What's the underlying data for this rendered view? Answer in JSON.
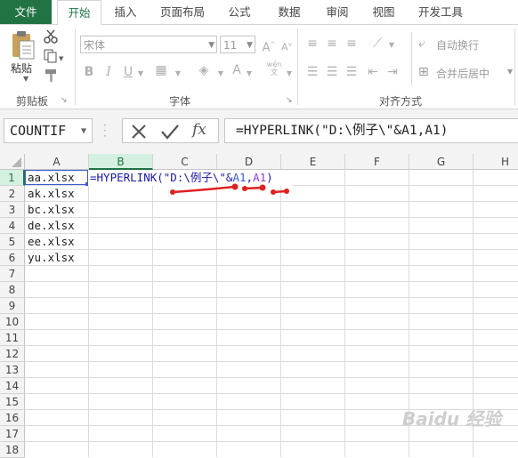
{
  "tabs": [
    "文件",
    "开始",
    "插入",
    "页面布局",
    "公式",
    "数据",
    "审阅",
    "视图",
    "开发工具"
  ],
  "active_tab": "开始",
  "ribbon": {
    "clipboard": {
      "paste_label": "粘贴",
      "group_label": "剪贴板"
    },
    "font": {
      "font_name": "宋体",
      "font_size": "11",
      "group_label": "字体",
      "bold": "B",
      "italic": "I",
      "underline": "U",
      "font_color": "A",
      "phonetic": "wén"
    },
    "alignment": {
      "wrap_text": "自动换行",
      "merge_center": "合并后居中",
      "group_label": "对齐方式"
    }
  },
  "formula_bar": {
    "name_box": "COUNTIF",
    "formula": "=HYPERLINK(\"D:\\例子\\\"&A1,A1)",
    "fx": "fx"
  },
  "columns": [
    "A",
    "B",
    "C",
    "D",
    "E",
    "F",
    "G",
    "H"
  ],
  "rows": [
    "1",
    "2",
    "3",
    "4",
    "5",
    "6",
    "7",
    "8",
    "9",
    "10",
    "11",
    "12",
    "13",
    "14",
    "15",
    "16",
    "17",
    "18"
  ],
  "cells": {
    "A": [
      "aa.xlsx",
      "ak.xlsx",
      "bc.xlsx",
      "de.xlsx",
      "ee.xlsx",
      "yu.xlsx"
    ],
    "B1_parts": {
      "head": "=HYPERLINK(\"D:\\例子\\\"&",
      "ref1": "A1",
      "comma": ",",
      "ref2": "A1",
      "tail": ")"
    }
  },
  "colors": {
    "excel_green": "#217346",
    "annotation_red": "#e02020",
    "formula_blue": "#1a1aa6"
  },
  "watermark": "Baidu 经验"
}
